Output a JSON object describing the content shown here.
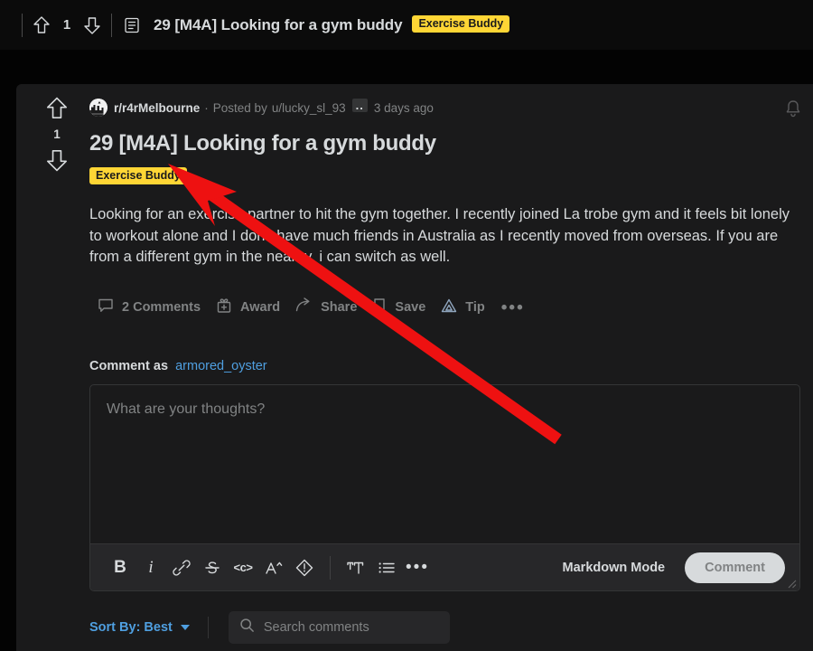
{
  "topbar": {
    "score": "1",
    "upvote_label": "upvote",
    "downvote_label": "downvote",
    "title": "29 [M4A] Looking for a gym buddy",
    "flair": "Exercise Buddy"
  },
  "post": {
    "score": "1",
    "subreddit": "r/r4rMelbourne",
    "separator": "·",
    "posted_by": "Posted by",
    "author": "u/lucky_sl_93",
    "author_badge": "..",
    "age": "3 days ago",
    "title": "29 [M4A] Looking for a gym buddy",
    "flair": "Exercise Buddy",
    "selftext": "Looking for an exercise partner to hit the gym together. I recently joined La trobe gym and it feels bit lonely to workout alone and I don’t have much friends in Australia as I recently moved from overseas. If you are from a different gym in the nearby, i can switch as well.",
    "actions": {
      "comments": "2 Comments",
      "award": "Award",
      "share": "Share",
      "save": "Save",
      "tip": "Tip",
      "more": "•••"
    }
  },
  "comment_box": {
    "comment_as_label": "Comment as",
    "username": "armored_oyster",
    "placeholder": "What are your thoughts?",
    "toolbar": {
      "bold": "B",
      "italic": "i",
      "link": "link-icon",
      "strikethrough": "strikethrough-icon",
      "inline_code": "<c>",
      "superscript": "A^",
      "spoiler": "spoiler-icon",
      "heading": "heading-icon",
      "bulleted_list": "list-icon",
      "more": "•••"
    },
    "markdown_mode": "Markdown Mode",
    "submit": "Comment"
  },
  "sortbar": {
    "sort_label": "Sort By: Best",
    "search_placeholder": "Search comments"
  },
  "colors": {
    "page_bg": "#030303",
    "card_bg": "#1a1a1b",
    "topbar_bg": "#0b0b0b",
    "flair_bg": "#ffd635",
    "flair_text": "#1a1a1b",
    "text_primary": "#d7dadc",
    "text_secondary": "#818384",
    "link_blue": "#4f9fe0",
    "annotation_red": "#ee1111",
    "toolbar_bg": "#272729",
    "border": "#343536"
  }
}
